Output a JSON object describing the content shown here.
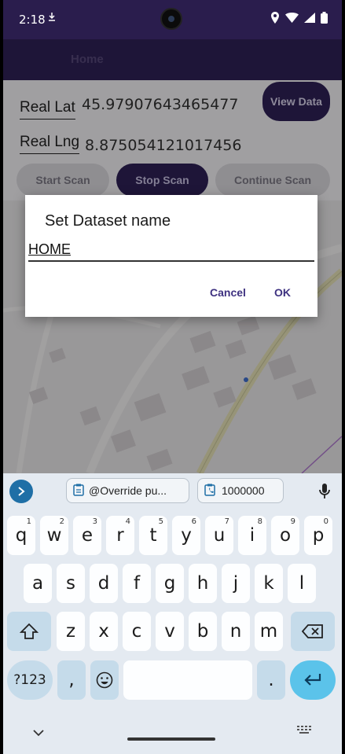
{
  "status_bar": {
    "time": "2:18"
  },
  "app_bar": {
    "title": "Home"
  },
  "fields": {
    "lat_label": "Real Lat",
    "lat_value": "45.97907643465477",
    "lng_label": "Real Lng",
    "lng_value": "8.875054121017456"
  },
  "buttons": {
    "view_data": "View Data",
    "start_scan": "Start Scan",
    "stop_scan": "Stop Scan",
    "continue_scan": "Continue Scan"
  },
  "dialog": {
    "title": "Set Dataset name",
    "input_value": "HOME",
    "cancel": "Cancel",
    "ok": "OK"
  },
  "keyboard": {
    "clip1": "@Override pu...",
    "clip2": "1000000",
    "row1": [
      {
        "k": "q",
        "h": "1"
      },
      {
        "k": "w",
        "h": "2"
      },
      {
        "k": "e",
        "h": "3"
      },
      {
        "k": "r",
        "h": "4"
      },
      {
        "k": "t",
        "h": "5"
      },
      {
        "k": "y",
        "h": "6"
      },
      {
        "k": "u",
        "h": "7"
      },
      {
        "k": "i",
        "h": "8"
      },
      {
        "k": "o",
        "h": "9"
      },
      {
        "k": "p",
        "h": "0"
      }
    ],
    "row2": [
      "a",
      "s",
      "d",
      "f",
      "g",
      "h",
      "j",
      "k",
      "l"
    ],
    "row3": [
      "z",
      "x",
      "c",
      "v",
      "b",
      "n",
      "m"
    ],
    "symbols": "?123",
    "comma": ",",
    "period": "."
  },
  "colors": {
    "primary": "#2e2157",
    "status_bar": "#2a1d4d",
    "dialog_action": "#3e3180",
    "enter_key": "#5bc3ea"
  }
}
